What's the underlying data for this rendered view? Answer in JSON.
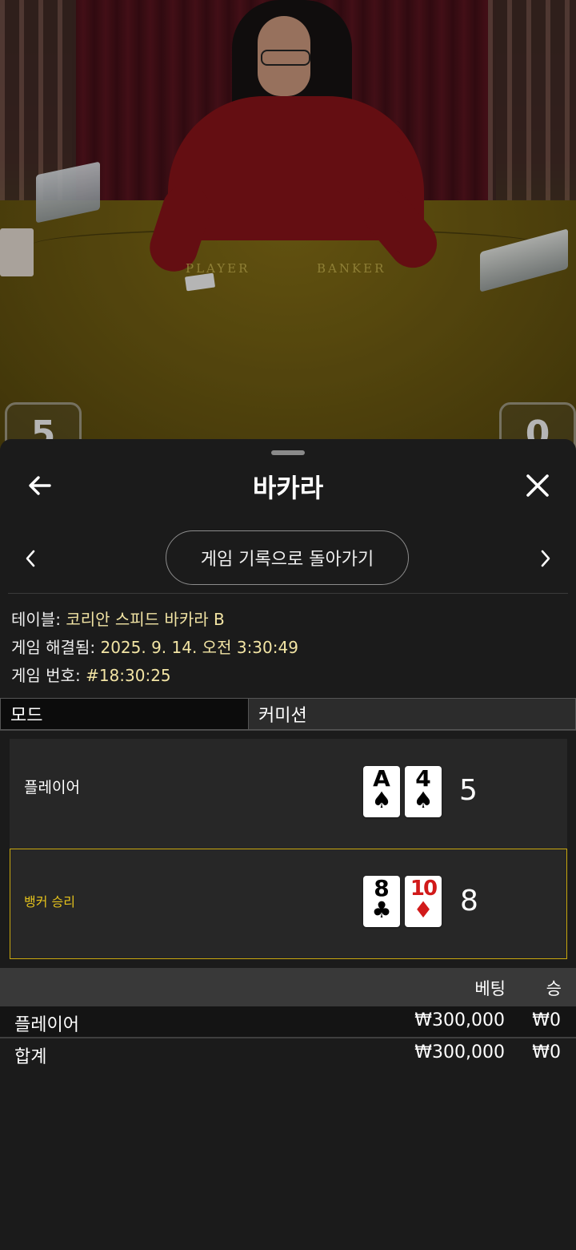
{
  "video": {
    "felt_player": "PLAYER",
    "felt_banker": "BANKER",
    "player_score": "5",
    "banker_score": "0"
  },
  "sheet": {
    "title": "바카라",
    "back_icon": "arrow-left-icon",
    "close_icon": "close-icon",
    "history_button": "게임 기록으로 돌아가기",
    "prev_icon": "chevron-left-icon",
    "next_icon": "chevron-right-icon"
  },
  "info": {
    "table_label": "테이블:",
    "table_value": "코리안 스피드 바카라 B",
    "resolved_label": "게임 해결됨:",
    "resolved_value": "2025. 9. 14. 오전 3:30:49",
    "number_label": "게임 번호:",
    "number_value": "#18:30:25"
  },
  "mode": {
    "mode_label": "모드",
    "commission_label": "커미션"
  },
  "hands": {
    "player": {
      "label": "플레이어",
      "cards": [
        {
          "rank": "A",
          "suit": "♠",
          "color": "#000000"
        },
        {
          "rank": "4",
          "suit": "♠",
          "color": "#000000"
        }
      ],
      "total": "5"
    },
    "banker": {
      "label": "뱅커 승리",
      "cards": [
        {
          "rank": "8",
          "suit": "♣",
          "color": "#000000"
        },
        {
          "rank": "10",
          "suit": "♦",
          "color": "#d11a1a"
        }
      ],
      "total": "8"
    }
  },
  "bets": {
    "header_bet": "베팅",
    "header_win": "승",
    "rows": [
      {
        "name": "플레이어",
        "bet": "₩300,000",
        "win": "₩0"
      }
    ],
    "total": {
      "name": "합계",
      "bet": "₩300,000",
      "win": "₩0"
    }
  },
  "colors": {
    "sheet_bg": "#1b1b1b",
    "value_text": "#f2e4a4",
    "winner_accent": "#c9a80e"
  }
}
